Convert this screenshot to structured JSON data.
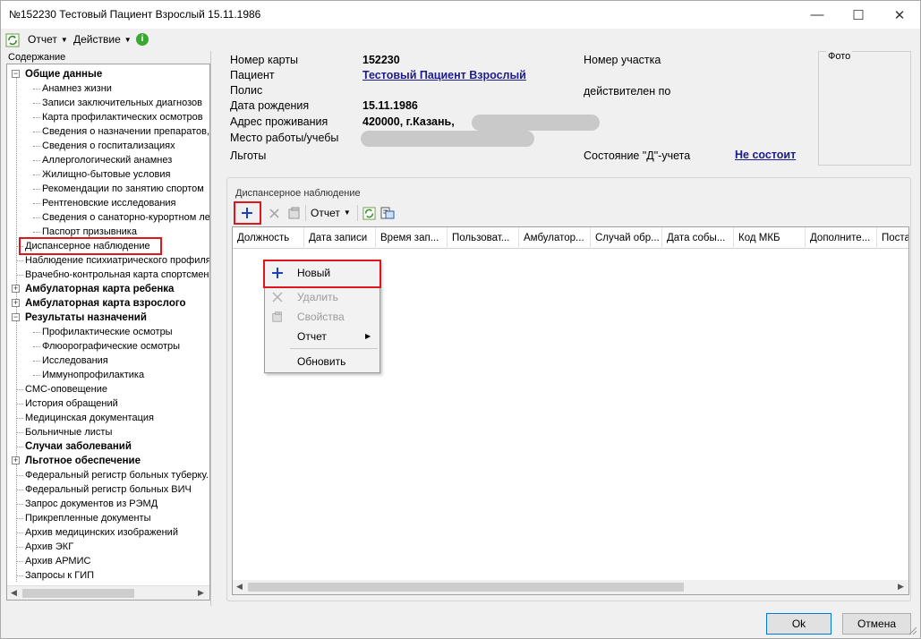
{
  "window": {
    "title": "№152230 Тестовый Пациент Взрослый 15.11.1986",
    "minimize": "—",
    "maximize": "☐",
    "close": "✕"
  },
  "menu": {
    "report": "Отчет",
    "action": "Действие"
  },
  "left_panel": {
    "caption": "Содержание",
    "tree": [
      {
        "label": "Общие данные",
        "bold": true,
        "expander": "−"
      },
      {
        "label": "Анамнез жизни"
      },
      {
        "label": "Записи заключительных диагнозов"
      },
      {
        "label": "Карта профилактических осмотров"
      },
      {
        "label": "Сведения о назначении препаратов,"
      },
      {
        "label": "Сведения о госпитализациях"
      },
      {
        "label": "Аллергологический анамнез"
      },
      {
        "label": "Жилищно-бытовые условия"
      },
      {
        "label": "Рекомендации по занятию спортом"
      },
      {
        "label": "Рентгеновские исследования"
      },
      {
        "label": "Сведения о санаторно-курортном лече"
      },
      {
        "label": "Паспорт призывника"
      },
      {
        "label": "Диспансерное наблюдение",
        "selected": true
      },
      {
        "label": "Наблюдение психиатрического профиля"
      },
      {
        "label": "Врачебно-контрольная карта спортсмен"
      },
      {
        "label": "Амбулаторная карта ребенка",
        "bold": true,
        "expander": "+"
      },
      {
        "label": "Амбулаторная карта взрослого",
        "bold": true,
        "expander": "+"
      },
      {
        "label": "Результаты назначений",
        "bold": true,
        "expander": "−"
      },
      {
        "label": "Профилактические осмотры"
      },
      {
        "label": "Флюорографические осмотры"
      },
      {
        "label": "Исследования"
      },
      {
        "label": "Иммунопрофилактика"
      },
      {
        "label": "СМС-оповещение"
      },
      {
        "label": "История обращений"
      },
      {
        "label": "Медицинская документация"
      },
      {
        "label": "Больничные листы"
      },
      {
        "label": "Случаи заболеваний",
        "bold": true
      },
      {
        "label": "Льготное обеспечение",
        "bold": true,
        "expander": "+"
      },
      {
        "label": "Федеральный регистр больных туберку."
      },
      {
        "label": "Федеральный регистр больных ВИЧ"
      },
      {
        "label": "Запрос документов из РЭМД"
      },
      {
        "label": "Прикрепленные документы"
      },
      {
        "label": "Архив медицинских изображений"
      },
      {
        "label": "Архив ЭКГ"
      },
      {
        "label": "Архив АРМИС"
      },
      {
        "label": "Запросы к ГИП"
      }
    ]
  },
  "patient": {
    "card_number_label": "Номер карты",
    "card_number": "152230",
    "patient_label": "Пациент",
    "patient_name": "Тестовый Пациент Взрослый",
    "policy_label": "Полис",
    "birth_label": "Дата рождения",
    "birth_date": "15.11.1986",
    "address_label": "Адрес проживания",
    "address": "420000, г.Казань,",
    "work_label": "Место работы/учебы",
    "benefits_label": "Льготы",
    "district_label": "Номер участка",
    "valid_label": "действителен по",
    "d_status_label": "Состояние \"Д\"-учета",
    "d_status_value": "Не состоит",
    "photo_label": "Фото"
  },
  "dispensary": {
    "caption": "Диспансерное наблюдение",
    "toolbar_report": "Отчет",
    "columns": [
      "Должность",
      "Дата записи",
      "Время зап...",
      "Пользоват...",
      "Амбулатор...",
      "Случай обр...",
      "Дата собы...",
      "Код МКБ",
      "Дополните...",
      "Поста"
    ]
  },
  "context_menu": {
    "new": "Новый",
    "delete": "Удалить",
    "properties": "Свойства",
    "report": "Отчет",
    "refresh": "Обновить"
  },
  "buttons": {
    "ok": "Ok",
    "cancel": "Отмена"
  },
  "colors": {
    "highlight": "#e0161c",
    "link": "#1c1c8c",
    "plus_icon": "#1a3fbf"
  }
}
